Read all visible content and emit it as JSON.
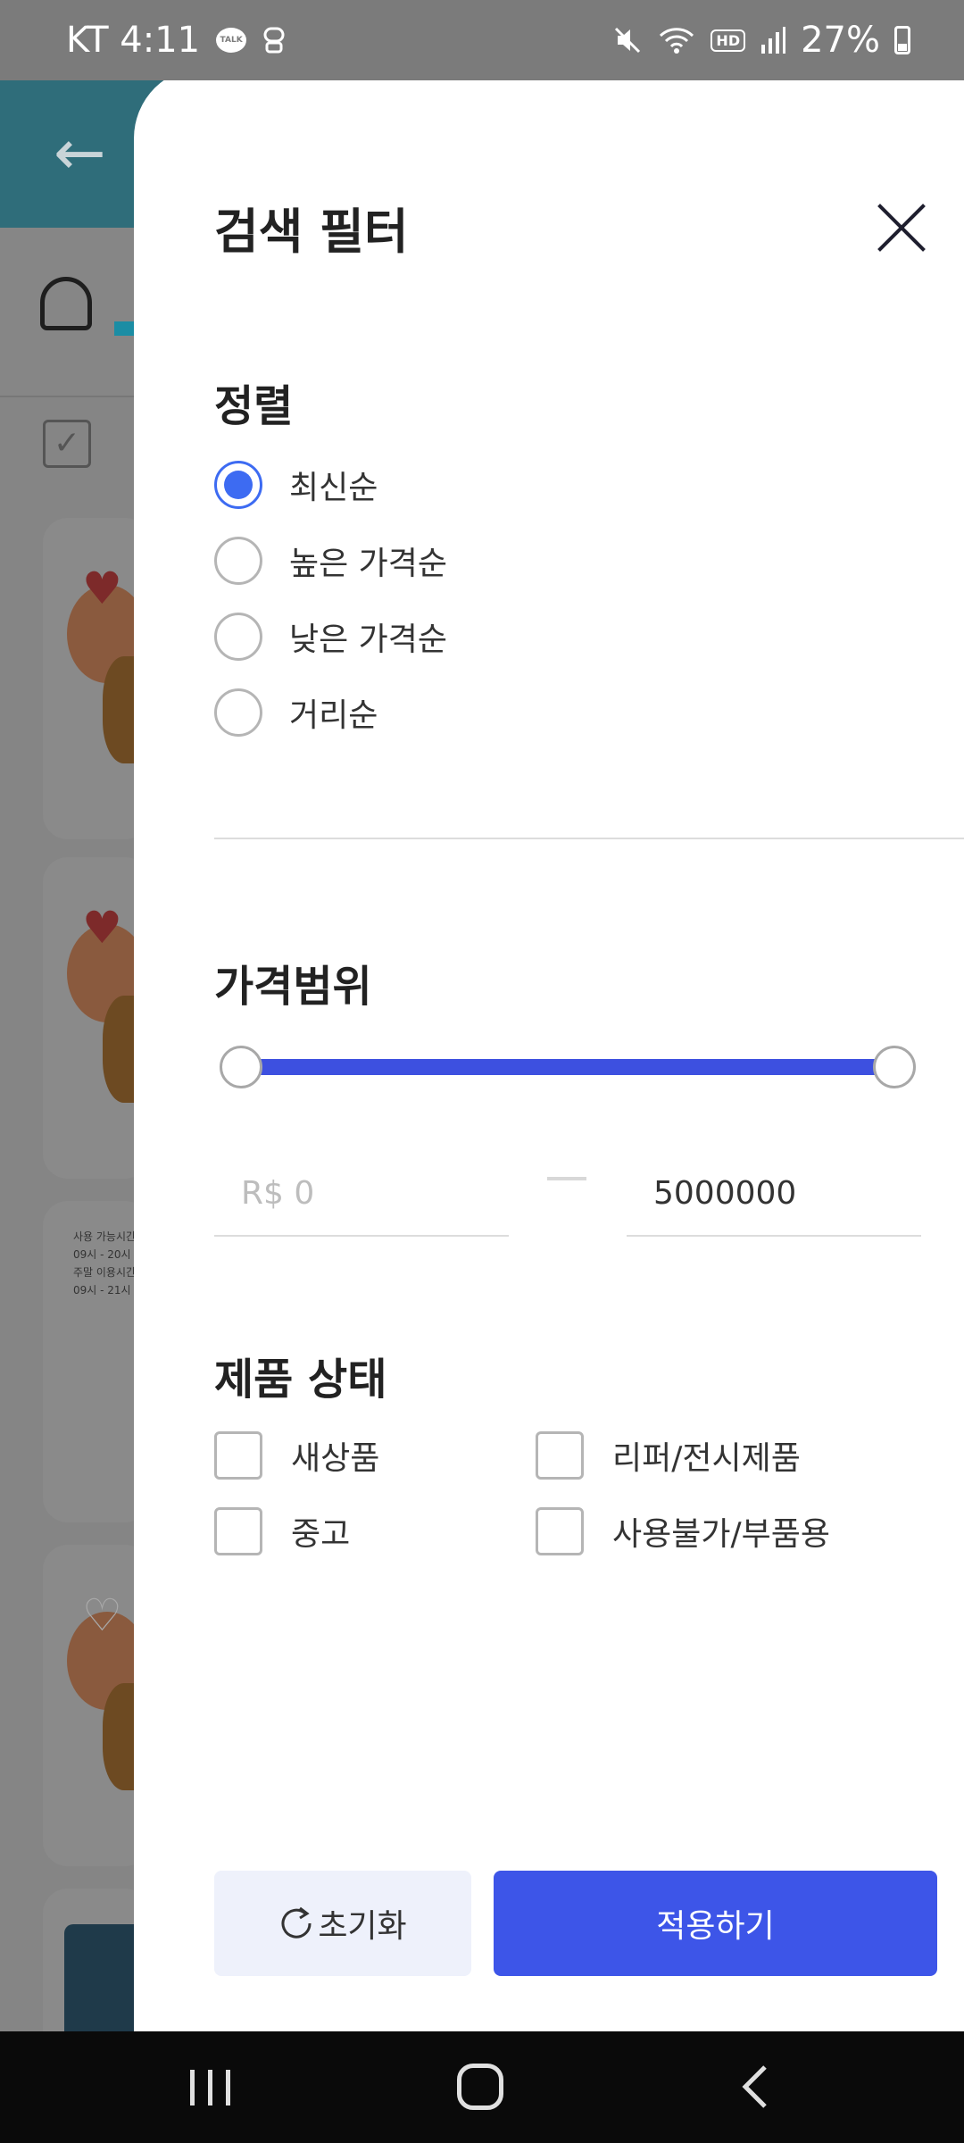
{
  "status_bar": {
    "carrier_time": "KT 4:11",
    "talk_badge": "TALK",
    "hd_badge": "HD",
    "battery": "27%",
    "icons": [
      "talk-icon",
      "notification-app-icon",
      "mute-icon",
      "wifi-icon",
      "hd-voice-icon",
      "signal-icon",
      "battery-icon"
    ]
  },
  "filter": {
    "title": "검색 필터",
    "sort": {
      "title": "정렬",
      "options": [
        {
          "label": "최신순",
          "checked": true
        },
        {
          "label": "높은 가격순",
          "checked": false
        },
        {
          "label": "낮은 가격순",
          "checked": false
        },
        {
          "label": "거리순",
          "checked": false
        }
      ]
    },
    "price": {
      "title": "가격범위",
      "min_placeholder": "R$ 0",
      "max_value": "5000000",
      "range_fraction": [
        0,
        1
      ]
    },
    "condition": {
      "title": "제품 상태",
      "options": [
        {
          "label": "새상품",
          "checked": false
        },
        {
          "label": "리퍼/전시제품",
          "checked": false
        },
        {
          "label": "중고",
          "checked": false
        },
        {
          "label": "사용불가/부품용",
          "checked": false
        }
      ]
    },
    "buttons": {
      "reset": "초기화",
      "apply": "적용하기"
    }
  },
  "background_page": {
    "snippet_line1": "사용 가능시간",
    "snippet_line2": "09시 - 20시",
    "snippet_line3": "주말 이용시간",
    "snippet_line4": "09시 - 21시"
  },
  "colors": {
    "accent": "#3d55e8",
    "radio_checked": "#3d6bf2",
    "reset_bg": "#eef1fb"
  }
}
